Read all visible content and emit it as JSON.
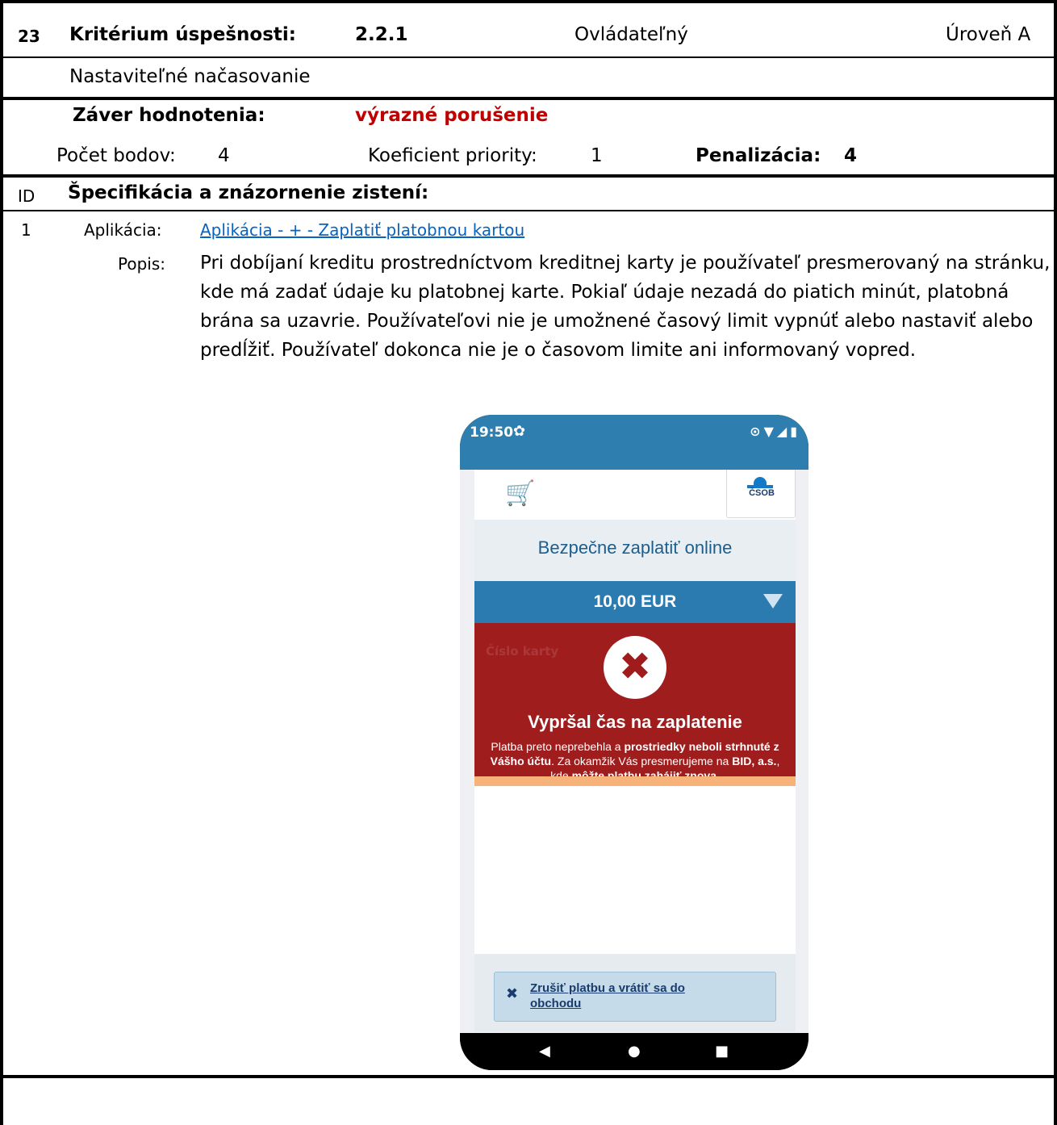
{
  "header": {
    "number": "23",
    "criterion_label": "Kritérium úspešnosti:",
    "criterion_id": "2.2.1",
    "principle": "Ovládateľný",
    "level": "Úroveň A"
  },
  "criterion_name": "Nastaviteľné načasovanie",
  "evaluation": {
    "label": "Záver hodnotenia:",
    "value": "výrazné porušenie",
    "points_label": "Počet bodov:",
    "points": "4",
    "priority_label": "Koeficient priority:",
    "priority": "1",
    "penalty_label": "Penalizácia:",
    "penalty": "4"
  },
  "spec": {
    "id_label": "ID",
    "title": "Špecifikácia a znázornenie zistení:"
  },
  "finding": {
    "id": "1",
    "app_label": "Aplikácia:",
    "app_link": "Aplikácia - + - Zaplatiť platobnou kartou",
    "desc_label": "Popis:",
    "desc": "Pri dobíjaní kreditu prostredníctvom kreditnej karty je používateľ presmerovaný na stránku, kde má zadať údaje ku platobnej karte. Pokiaľ údaje nezadá do piatich minút, platobná brána sa uzavrie. Používateľovi nie je umožnené časový limit vypnúť alebo nastaviť alebo predĺžiť. Používateľ dokonca nie je o časovom limite ani informovaný vopred."
  },
  "phone": {
    "time": "19:50",
    "bank": "ČSOB",
    "page_title": "Bezpečne zaplatiť online",
    "amount": "10,00 EUR",
    "ghost_label": "Číslo karty",
    "error_title": "Vypršal čas na zaplatenie",
    "error_body_1": "Platba preto neprebehla a ",
    "error_body_2": "prostriedky neboli strhnuté z Vášho účtu",
    "error_body_3": ". Za okamžik Vás presmerujeme na ",
    "error_body_4": "BID, a.s.",
    "error_body_5": ", kde ",
    "error_body_6": "môžte platbu zahájiť znova",
    "error_body_7": ".",
    "cancel_label": "Zrušiť platbu a vrátiť sa do obchodu",
    "icon_names": [
      "settings-icon",
      "location-icon",
      "wifi-icon",
      "signal-icon",
      "battery-icon",
      "cart-icon",
      "csob-logo",
      "dropdown-triangle-icon",
      "error-x-icon",
      "close-icon",
      "back-icon",
      "home-icon",
      "recents-icon"
    ],
    "colors": {
      "statusbar": "#2e7fb0",
      "error": "#9f1d1d",
      "amount_bar": "#2c7bb0",
      "accent_orange": "#f7b27a"
    }
  }
}
